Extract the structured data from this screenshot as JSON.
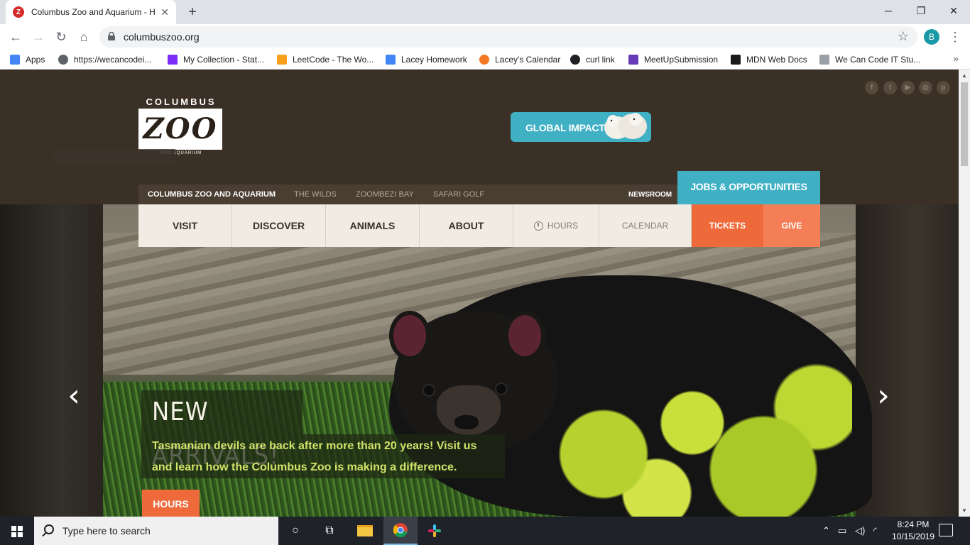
{
  "browser": {
    "tab_title": "Columbus Zoo and Aquarium - H",
    "url": "columbuszoo.org",
    "profile_initial": "B",
    "bookmarks": [
      {
        "label": "Apps",
        "icon": "apps-grid-icon",
        "color": "#4285f4"
      },
      {
        "label": "https://wecancodei...",
        "icon": "globe-icon",
        "color": "#5f6368"
      },
      {
        "label": "My Collection - Stat...",
        "icon": "purple-p-icon",
        "color": "#7b2ff7"
      },
      {
        "label": "LeetCode - The Wo...",
        "icon": "leetcode-icon",
        "color": "#f89f1b"
      },
      {
        "label": "Lacey Homework",
        "icon": "doc-icon",
        "color": "#4285f4"
      },
      {
        "label": "Lacey's Calendar",
        "icon": "hubspot-icon",
        "color": "#f57722"
      },
      {
        "label": "curl link",
        "icon": "github-icon",
        "color": "#202124"
      },
      {
        "label": "MeetUpSubmission",
        "icon": "form-icon",
        "color": "#673ab7"
      },
      {
        "label": "MDN Web Docs",
        "icon": "mdn-icon",
        "color": "#1a1a1a"
      },
      {
        "label": "We Can Code IT Stu...",
        "icon": "wcci-icon",
        "color": "#9aa0a6"
      }
    ]
  },
  "site": {
    "logo": {
      "top": "COLUMBUS",
      "main": "ZOO",
      "bottom": "AND AQUARIUM"
    },
    "global_impact": "GLOBAL IMPACT",
    "social": [
      "f",
      "t",
      "▶",
      "◎",
      "p"
    ],
    "subnav": {
      "items": [
        "COLUMBUS ZOO AND AQUARIUM",
        "THE WILDS",
        "ZOOMBEZI BAY",
        "SAFARI GOLF"
      ],
      "newsroom": "NEWSROOM",
      "jobs": "JOBS & OPPORTUNITIES"
    },
    "mainnav": {
      "visit": "VISIT",
      "discover": "DISCOVER",
      "animals": "ANIMALS",
      "about": "ABOUT",
      "hours": "HOURS",
      "calendar": "CALENDAR",
      "tickets": "TICKETS",
      "give": "GIVE"
    },
    "hero": {
      "headline": "NEW ARRIVALS!",
      "blurb_line1": "Tasmanian devils are back after more than 20 years! Visit us",
      "blurb_line2": "and learn how the Columbus Zoo is making a difference.",
      "cta": "HOURS"
    },
    "colors": {
      "teal": "#40b0c4",
      "orange": "#ef6a3a",
      "brown": "#3b3025"
    }
  },
  "taskbar": {
    "search_placeholder": "Type here to search",
    "time": "8:24 PM",
    "date": "10/15/2019"
  }
}
